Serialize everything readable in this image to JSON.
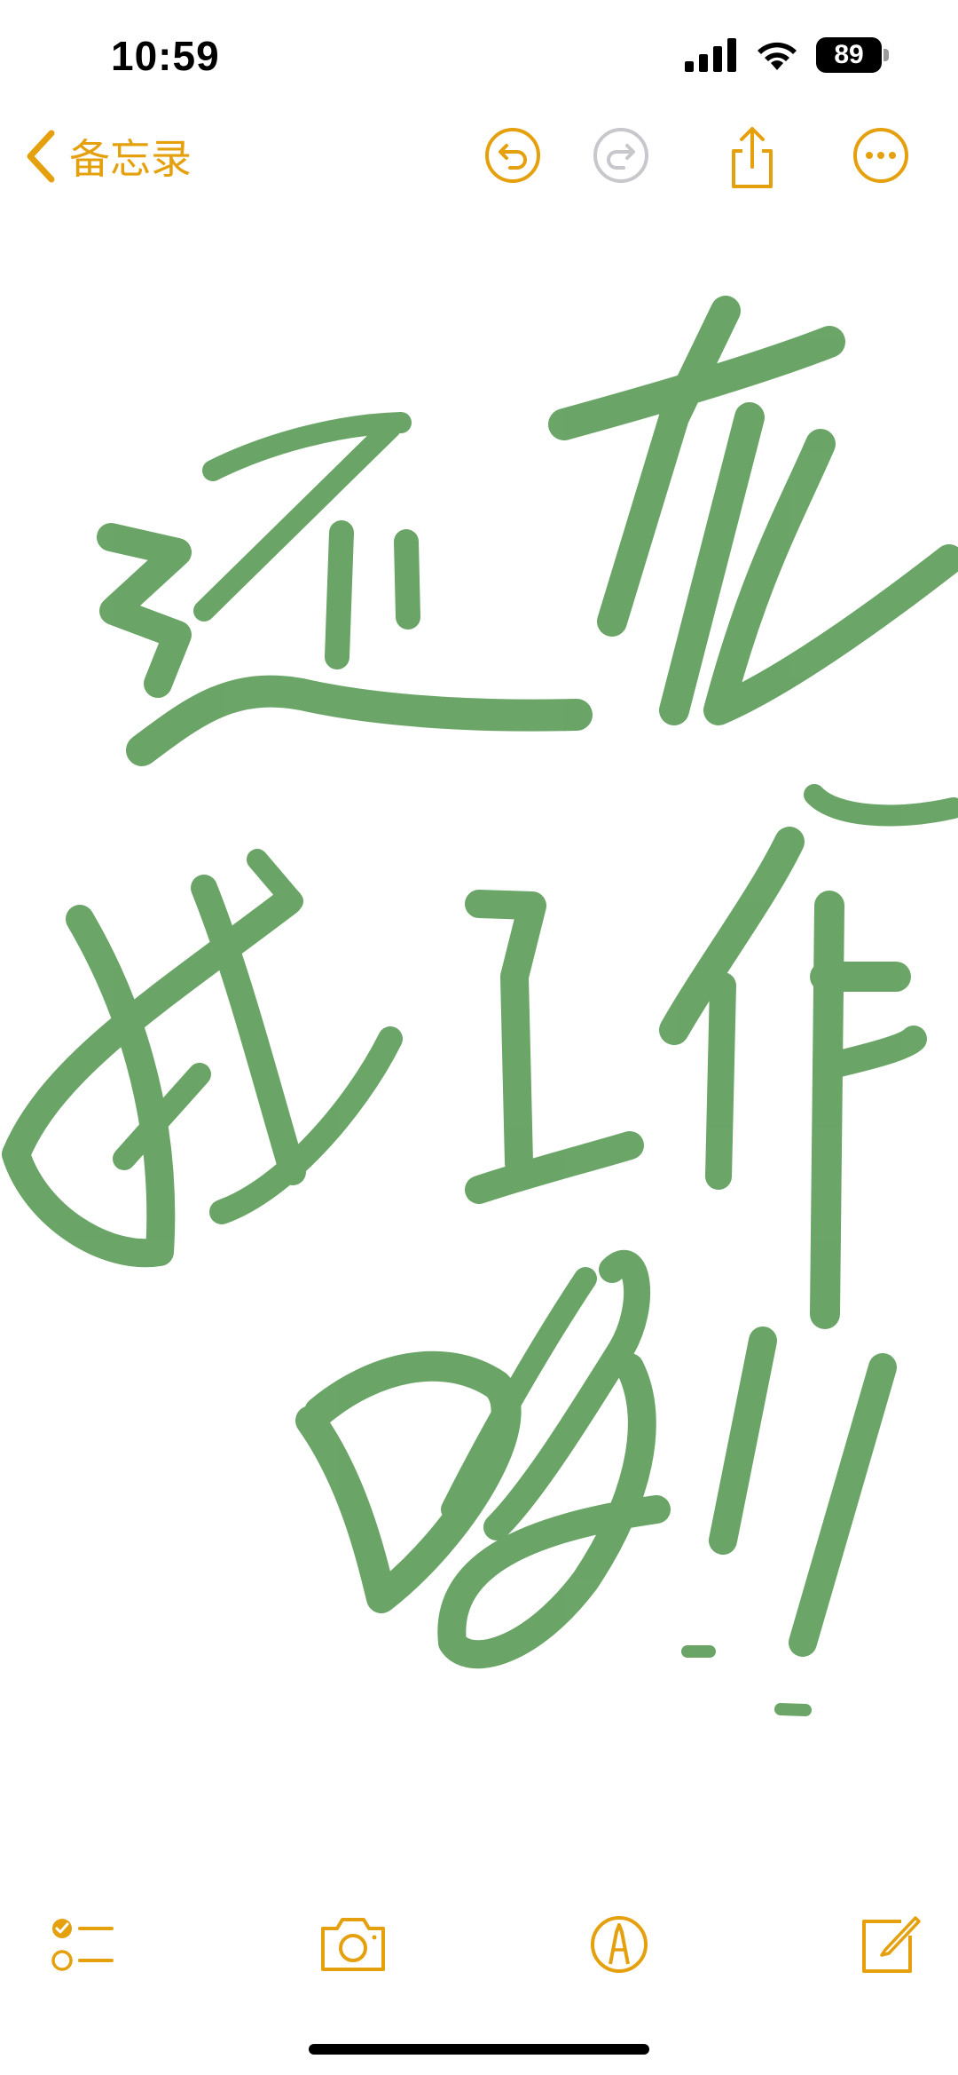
{
  "status_bar": {
    "time": "10:59",
    "battery_percent": "89",
    "signal_bars": 4,
    "wifi": true
  },
  "nav": {
    "back_label": "备忘录",
    "accent_color": "#E5A00D",
    "buttons": [
      "undo-icon",
      "redo-icon",
      "share-icon",
      "more-icon"
    ],
    "redo_enabled": false
  },
  "drawing": {
    "stroke_color": "#5E9E5B",
    "tool": "marker"
  },
  "toolbar": {
    "tools": [
      "checklist-icon",
      "camera-icon",
      "markup-icon",
      "compose-icon"
    ]
  }
}
